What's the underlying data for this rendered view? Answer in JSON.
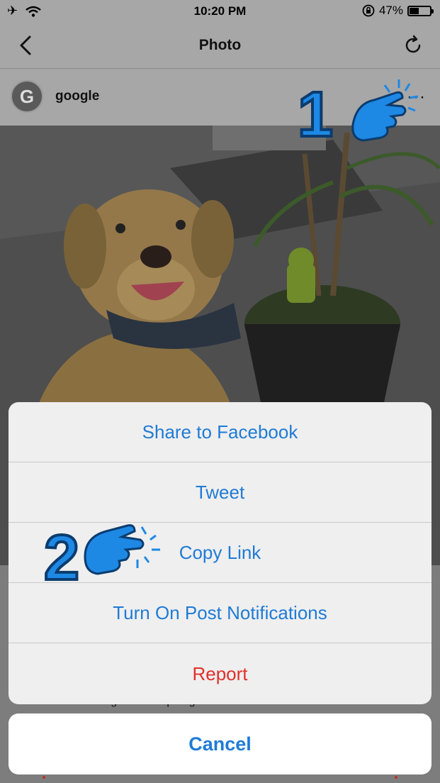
{
  "status_bar": {
    "time": "10:20 PM",
    "battery": "47%",
    "battery_level": 0.47
  },
  "nav": {
    "title": "Photo"
  },
  "post": {
    "username": "google",
    "avatar_letter": "G",
    "more": "···"
  },
  "caption_fragment": "that he's not too big to be a lap dog.",
  "action_sheet": {
    "items": [
      {
        "label": "Share to Facebook",
        "style": "default"
      },
      {
        "label": "Tweet",
        "style": "default"
      },
      {
        "label": "Copy Link",
        "style": "default"
      },
      {
        "label": "Turn On Post Notifications",
        "style": "default"
      },
      {
        "label": "Report",
        "style": "destructive"
      }
    ],
    "cancel_label": "Cancel"
  },
  "annotations": {
    "step1": "1",
    "step2": "2"
  },
  "colors": {
    "accent": "#1f7bd6",
    "destructive": "#e0302b",
    "annotation": "#1e88e5"
  }
}
